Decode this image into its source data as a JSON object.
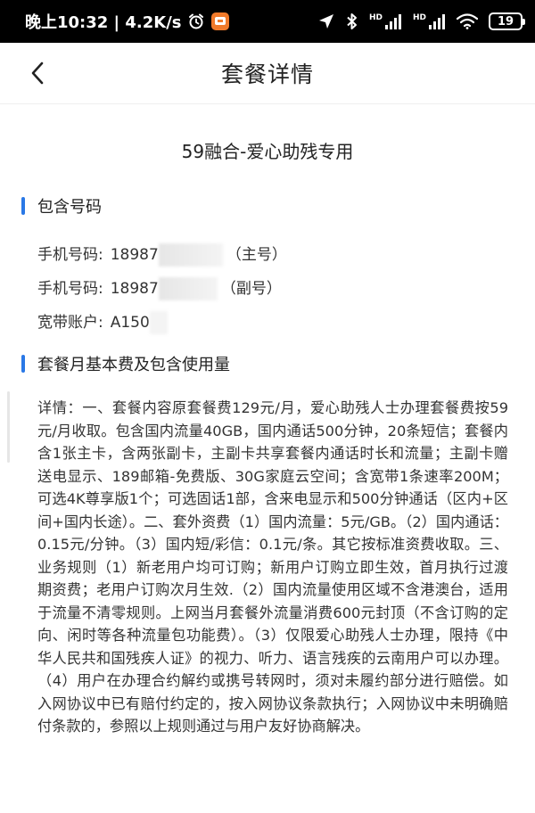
{
  "status_bar": {
    "time_speed": "晚上10:32 | 4.2K/s",
    "battery": "19",
    "hd_label_1": "HD",
    "hd_label_2": "HD"
  },
  "header": {
    "title": "套餐详情"
  },
  "plan": {
    "name": "59融合-爱心助残专用"
  },
  "included_numbers": {
    "section_title": "包含号码",
    "rows": [
      {
        "label": "手机号码:",
        "value": "18987",
        "suffix": "（主号）"
      },
      {
        "label": "手机号码:",
        "value": "18987",
        "suffix": "（副号）"
      },
      {
        "label": "宽带账户:",
        "value": "A150",
        "suffix": ""
      }
    ]
  },
  "monthly_fee": {
    "section_title": "套餐月基本费及包含使用量",
    "detail": "详情：一、套餐内容原套餐费129元/月，爱心助残人士办理套餐费按59元/月收取。包含国内流量40GB，国内通话500分钟，20条短信；套餐内含1张主卡，含两张副卡，主副卡共享套餐内通话时长和流量；主副卡赠送电显示、189邮箱-免费版、30G家庭云空间；含宽带1条速率200M；可选4K尊享版1个；可选固话1部，含来电显示和500分钟通话（区内+区间+国内长途）。二、套外资费（1）国内流量：5元/GB。（2）国内通话：0.15元/分钟。（3）国内短/彩信：0.1元/条。其它按标准资费收取。三、业务规则（1）新老用户均可订购；新用户订购立即生效，首月执行过渡期资费；老用户订购次月生效.（2）国内流量使用区域不含港澳台，适用于流量不清零规则。上网当月套餐外流量消费600元封顶（不含订购的定向、闲时等各种流量包功能费）。（3）仅限爱心助残人士办理，限持《中华人民共和国残疾人证》的视力、听力、语言残疾的云南用户可以办理。（4）用户在办理合约解约或携号转网时，须对未履约部分进行赔偿。如入网协议中已有赔付约定的，按入网协议条款执行；入网协议中未明确赔付条款的，参照以上规则通过与用户友好协商解决。"
  },
  "icons": {
    "alarm": "alarm-clock-icon",
    "app_badge": "app-badge-icon",
    "location": "location-arrow-icon",
    "bluetooth": "bluetooth-icon",
    "signal": "signal-bars-icon",
    "wifi": "wifi-icon",
    "battery": "battery-icon",
    "back": "chevron-left-icon"
  },
  "colors": {
    "accent": "#2a78e6",
    "status_bar_bg": "#000000"
  }
}
